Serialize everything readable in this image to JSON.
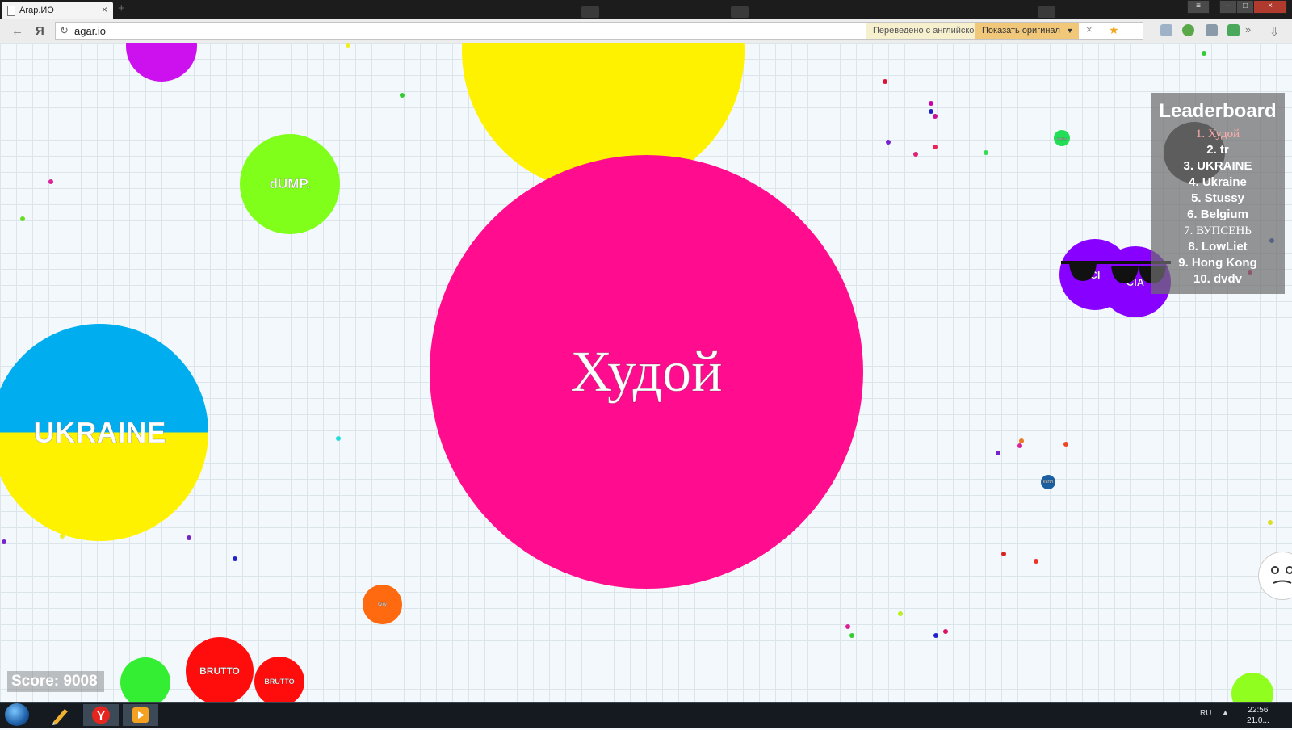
{
  "browser": {
    "tab_title": "Агар.ИО",
    "tab_close": "×",
    "new_tab": "+",
    "back_icon": "←",
    "yandex_logo": "Я",
    "reload_icon": "↻",
    "url": "agar.io",
    "translated_from": "Переведено с английского",
    "show_original": "Показать оригинал",
    "dropdown_caret": "▼",
    "translate_close": "×",
    "bookmark_star": "★",
    "overflow": "»",
    "download_icon": "⇩",
    "window_controls": {
      "minimize": "–",
      "maximize": "□",
      "close": "×",
      "menu": "≡"
    }
  },
  "game": {
    "cells": [
      {
        "name": "Худой",
        "color": "#ff0d8e"
      },
      {
        "name": "UKRAINE",
        "color_top": "#00aeef",
        "color_bottom": "#fff200"
      },
      {
        "name": "dUMP.",
        "color": "#80ff1a"
      },
      {
        "name": "CI",
        "color": "#8800ff"
      },
      {
        "name": "CIA",
        "color": "#8800ff"
      },
      {
        "name": "BRUTTO",
        "color": "#ff0d0d"
      },
      {
        "name": "BRUTTO",
        "color": "#ff0d0d"
      },
      {
        "name": "tyry",
        "color": "#ff6a10"
      },
      {
        "name": "earth",
        "color": "#1b5fa0"
      },
      {
        "name": "Kallus",
        "color": "#22dd55"
      }
    ],
    "leaderboard": {
      "title": "Leaderboard",
      "entries": [
        "1. Худой",
        "2. tr",
        "3. UKRAINE",
        "4. Ukraine",
        "5. Stussy",
        "6. Belgium",
        "7. ВУПСЕНЬ",
        "8. LowLiet",
        "9. Hong Kong",
        "10. dvdv"
      ]
    },
    "score": "Score: 9008"
  },
  "taskbar": {
    "language": "RU",
    "tray_arrow": "▲",
    "time": "22:56",
    "date": "21.0..."
  }
}
